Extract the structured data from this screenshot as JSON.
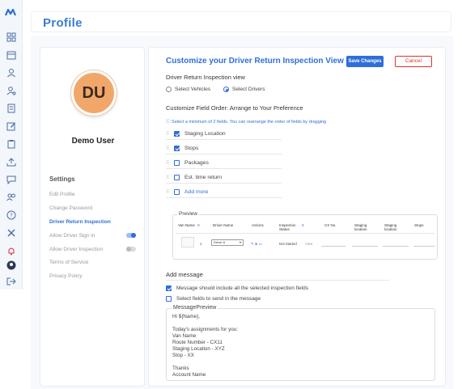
{
  "header": {
    "title": "Profile"
  },
  "profile": {
    "initials": "DU",
    "name": "Demo User",
    "colors": {
      "avatar_bg": "#f2a76a"
    }
  },
  "settings": {
    "heading": "Settings",
    "items": [
      {
        "label": "Edit Profile",
        "active": false
      },
      {
        "label": "Change Password",
        "active": false
      },
      {
        "label": "Driver Return Inspection",
        "active": true
      },
      {
        "label": "Allow Driver Sign in",
        "toggle": true
      },
      {
        "label": "Allow Driver Inspection",
        "toggle": false
      },
      {
        "label": "Terms of Service",
        "active": false
      },
      {
        "label": "Privacy Policy",
        "active": false
      }
    ]
  },
  "customize": {
    "title": "Customize your Driver Return Inspection View",
    "save_label": "Save Changes",
    "cancel_label": "Cancel",
    "view_label": "Driver Return Inspection view",
    "radio_vehicles": "Select Vehicles",
    "radio_drivers": "Select Drivers",
    "selected_view": "Select Drivers",
    "order_label": "Customize Field Order: Arrange to Your Preference",
    "hint": "Select a minimum of 2 fields. You can rearrange the order of fields by dragging",
    "fields": [
      {
        "label": "Staging Location",
        "checked": true
      },
      {
        "label": "Stops",
        "checked": true
      },
      {
        "label": "Packages",
        "checked": false
      },
      {
        "label": "Est. time return",
        "checked": false
      }
    ],
    "add_more": "Add more"
  },
  "preview": {
    "legend": "Preview",
    "headers": [
      "Van Name",
      "Driver Name",
      "Actions",
      "Inspection Status",
      "CX No.",
      "Staging location",
      "Staging location",
      "Stops"
    ],
    "row": {
      "van_index": "1",
      "driver": "Driver A",
      "status": "Not Started",
      "view": "View"
    }
  },
  "message": {
    "heading": "Add message",
    "option1": "Message should include all the selected inspection fields",
    "option2": "Select fields to send in the message",
    "legend": "MessagePreview",
    "lines": [
      "Hi ${Name},",
      "",
      "Today's assignments for you:",
      "Van Name",
      "Route Number - CX11",
      "Staging Location - XYZ",
      "Stop - XX",
      "",
      "Thanks",
      "Account Name"
    ]
  },
  "colors": {
    "accent": "#2f6fd6",
    "danger": "#dd3333"
  }
}
